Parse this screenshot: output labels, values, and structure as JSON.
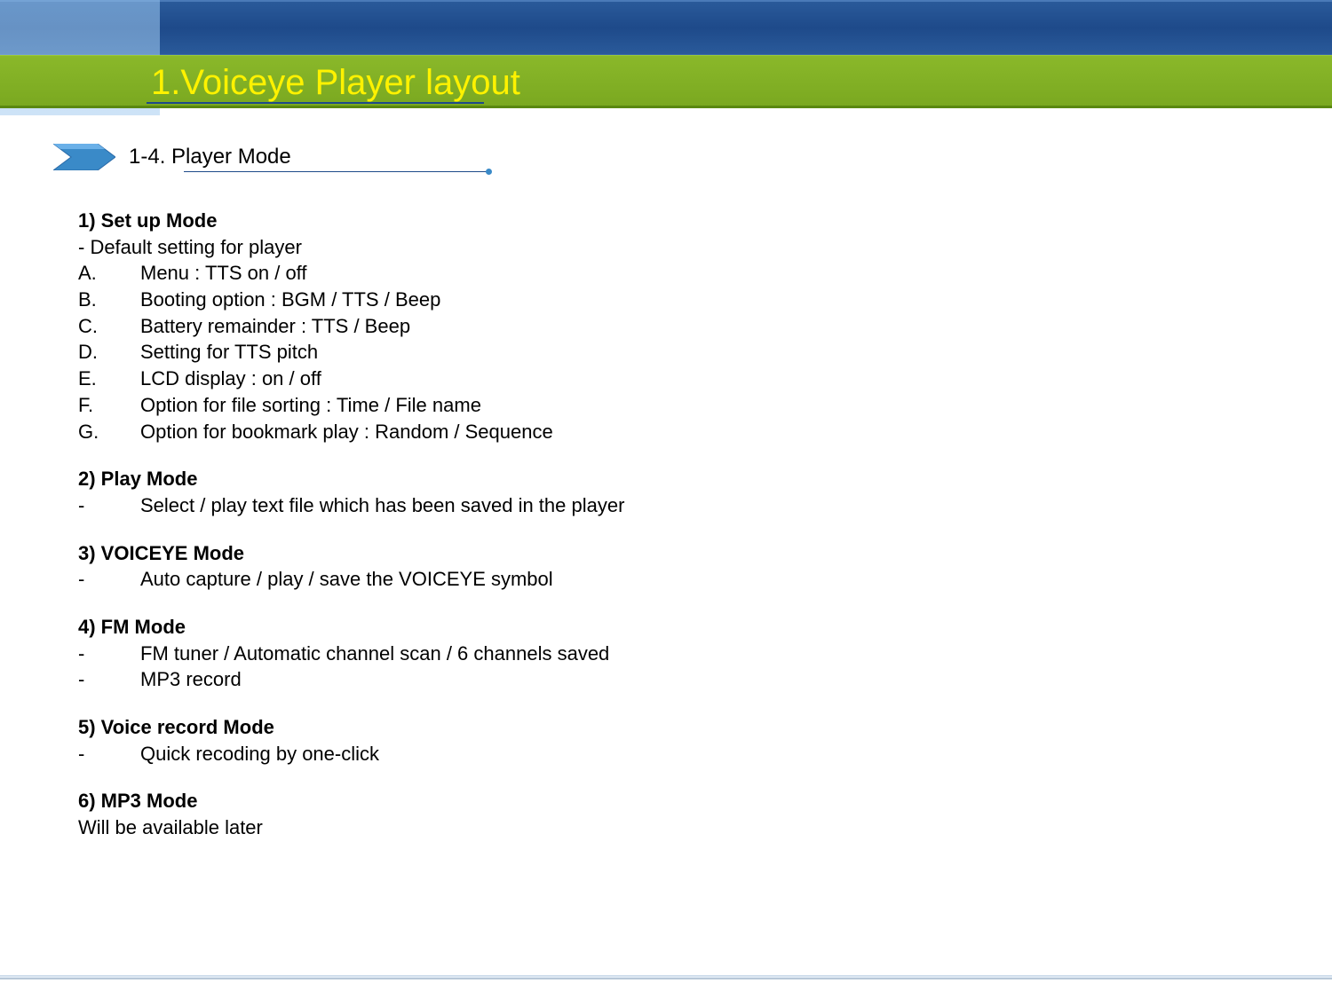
{
  "header": {
    "title": "1.Voiceye Player layout"
  },
  "subtitle": {
    "text": "1-4. Player Mode"
  },
  "sections": [
    {
      "title": "1) Set up Mode",
      "plain": "- Default setting for player",
      "items": [
        {
          "label": "A.",
          "text": "Menu : TTS on / off"
        },
        {
          "label": "B.",
          "text": "Booting option : BGM / TTS / Beep"
        },
        {
          "label": "C.",
          "text": "Battery remainder   : TTS / Beep"
        },
        {
          "label": "D.",
          "text": "Setting for TTS pitch"
        },
        {
          "label": "E.",
          "text": "LCD display : on / off"
        },
        {
          "label": "F.",
          "text": "Option for file sorting : Time / File name"
        },
        {
          "label": "G.",
          "text": "Option for bookmark play : Random / Sequence"
        }
      ]
    },
    {
      "title": "2) Play Mode",
      "items": [
        {
          "label": "-",
          "text": "Select / play text file which has been saved in the player"
        }
      ]
    },
    {
      "title": "3) VOICEYE Mode",
      "items": [
        {
          "label": "-",
          "text": "Auto capture / play / save the VOICEYE symbol"
        }
      ]
    },
    {
      "title": "4) FM Mode",
      "items": [
        {
          "label": "-",
          "text": "FM tuner / Automatic channel scan / 6 channels saved"
        },
        {
          "label": "-",
          "text": "MP3 record"
        }
      ]
    },
    {
      "title": "5) Voice record Mode",
      "items": [
        {
          "label": "-",
          "text": "Quick recoding by one-click"
        }
      ]
    },
    {
      "title": "6) MP3 Mode",
      "trailing": "Will be available later"
    }
  ]
}
